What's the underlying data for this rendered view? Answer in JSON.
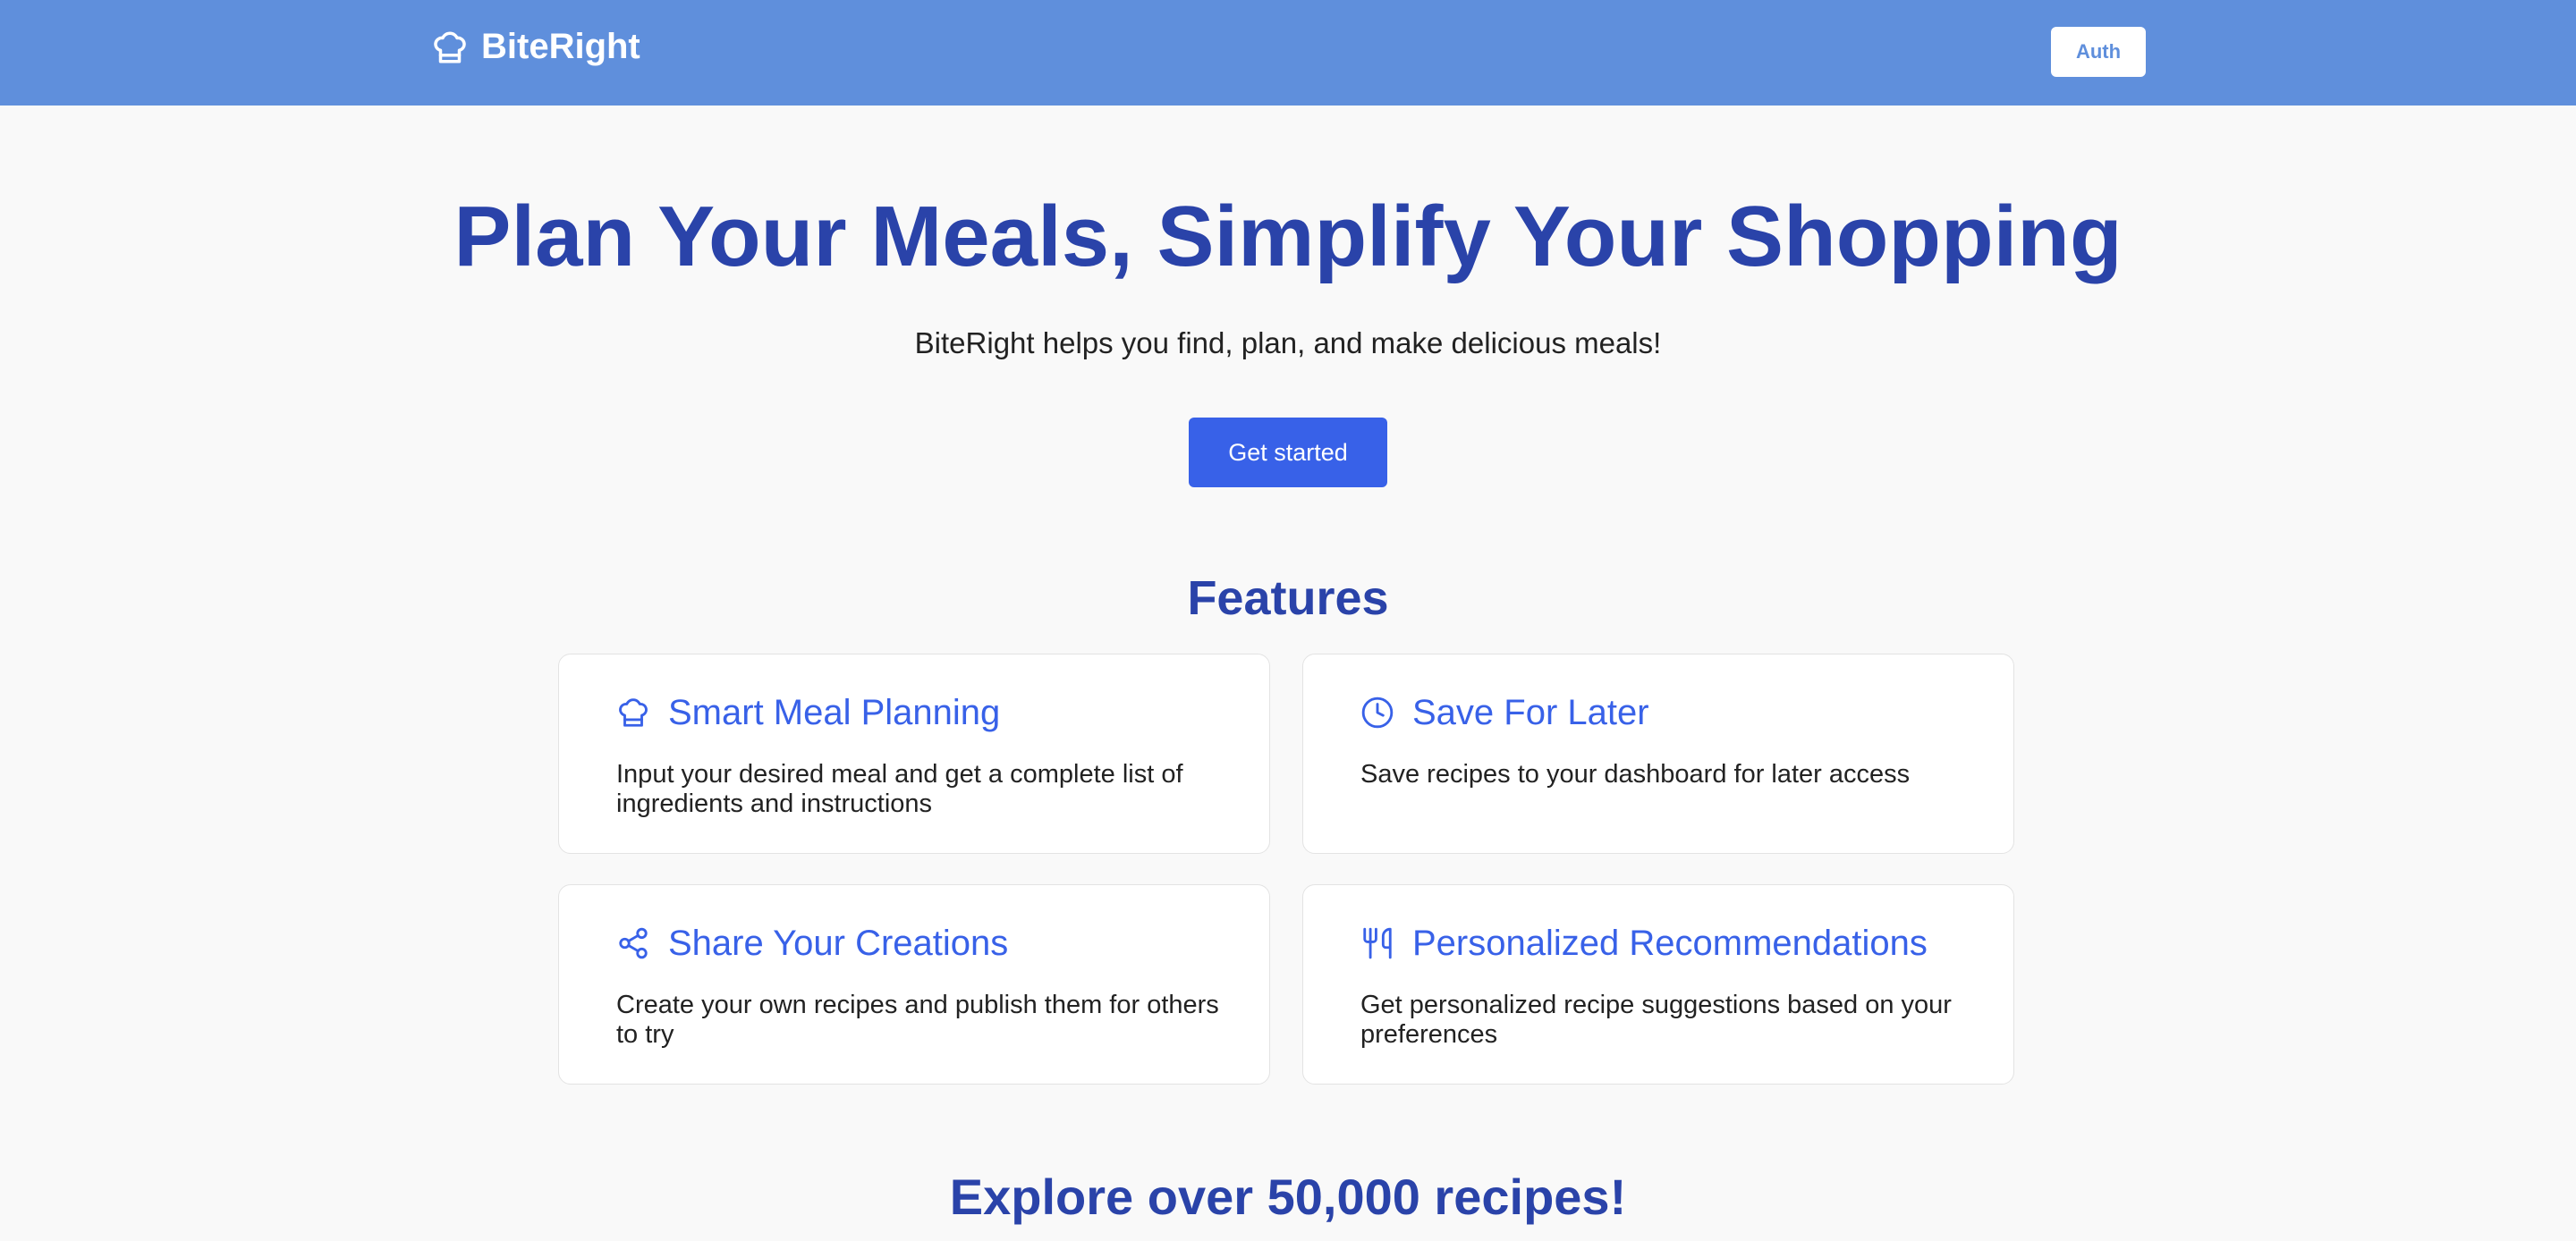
{
  "header": {
    "brand_name": "BiteRight",
    "logo_icon": "chef-hat-icon",
    "auth_label": "Auth"
  },
  "hero": {
    "title": "Plan Your Meals, Simplify Your Shopping",
    "subtitle": "BiteRight helps you find, plan, and make delicious meals!",
    "cta_label": "Get started"
  },
  "features": {
    "title": "Features",
    "items": [
      {
        "icon": "chef-hat-icon",
        "title": "Smart Meal Planning",
        "description": "Input your desired meal and get a complete list of ingredients and instructions"
      },
      {
        "icon": "clock-icon",
        "title": "Save For Later",
        "description": "Save recipes to your dashboard for later access"
      },
      {
        "icon": "share-icon",
        "title": "Share Your Creations",
        "description": "Create your own recipes and publish them for others to try"
      },
      {
        "icon": "utensils-icon",
        "title": "Personalized Recommendations",
        "description": "Get personalized recipe suggestions based on your preferences"
      }
    ]
  },
  "explore": {
    "title": "Explore over 50,000 recipes!"
  },
  "colors": {
    "navbar": "#5f8fdc",
    "heading": "#2a43a9",
    "accent": "#3861e8",
    "background": "#f9f9f9"
  }
}
